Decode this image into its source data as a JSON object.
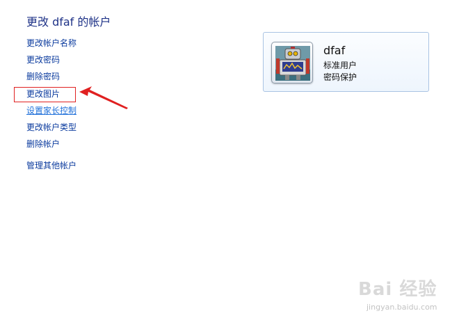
{
  "page": {
    "title": "更改 dfaf 的帐户"
  },
  "links": [
    {
      "label": "更改帐户名称"
    },
    {
      "label": "更改密码"
    },
    {
      "label": "删除密码"
    },
    {
      "label": "更改图片"
    },
    {
      "label": "设置家长控制"
    },
    {
      "label": "更改帐户类型"
    },
    {
      "label": "删除帐户"
    },
    {
      "label": "管理其他帐户"
    }
  ],
  "account": {
    "name": "dfaf",
    "type": "标准用户",
    "password_status": "密码保护",
    "avatar_icon": "robot-avatar-icon"
  },
  "annotation": {
    "color": "#e02020"
  },
  "watermark": {
    "logo": "Bai 经验",
    "url": "jingyan.baidu.com"
  },
  "colors": {
    "link": "#0b3b9e",
    "title": "#1e3287",
    "card_border": "#a9c3e3"
  }
}
